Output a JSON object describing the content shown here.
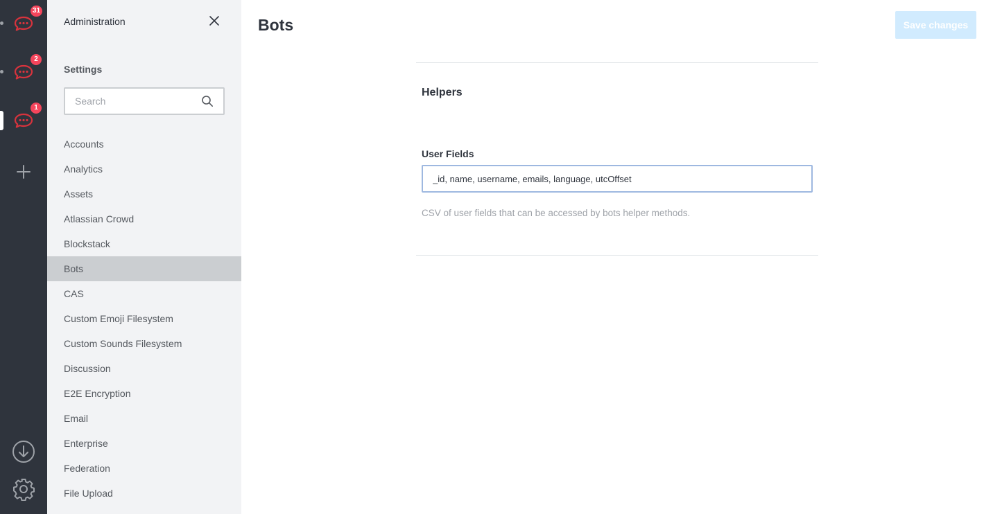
{
  "servers": [
    {
      "badge": "31",
      "active": false
    },
    {
      "badge": "2",
      "active": false
    },
    {
      "badge": "1",
      "active": true
    }
  ],
  "sidebar": {
    "title": "Administration",
    "section": "Settings",
    "search_placeholder": "Search",
    "items": [
      {
        "label": "Accounts"
      },
      {
        "label": "Analytics"
      },
      {
        "label": "Assets"
      },
      {
        "label": "Atlassian Crowd"
      },
      {
        "label": "Blockstack"
      },
      {
        "label": "Bots",
        "active": true
      },
      {
        "label": "CAS"
      },
      {
        "label": "Custom Emoji Filesystem"
      },
      {
        "label": "Custom Sounds Filesystem"
      },
      {
        "label": "Discussion"
      },
      {
        "label": "E2E Encryption"
      },
      {
        "label": "Email"
      },
      {
        "label": "Enterprise"
      },
      {
        "label": "Federation"
      },
      {
        "label": "File Upload"
      }
    ]
  },
  "main": {
    "title": "Bots",
    "save_label": "Save changes",
    "section_title": "Helpers",
    "field_label": "User Fields",
    "field_value": "_id, name, username, emails, language, utcOffset",
    "field_hint": "CSV of user fields that can be accessed by bots helper methods."
  },
  "colors": {
    "rail": "#2f343d",
    "sidebar": "#f2f3f5",
    "active_item": "#cbced1",
    "badge": "#f5455c",
    "logo": "#d8333d",
    "save_disabled": "#d1ebfe"
  }
}
